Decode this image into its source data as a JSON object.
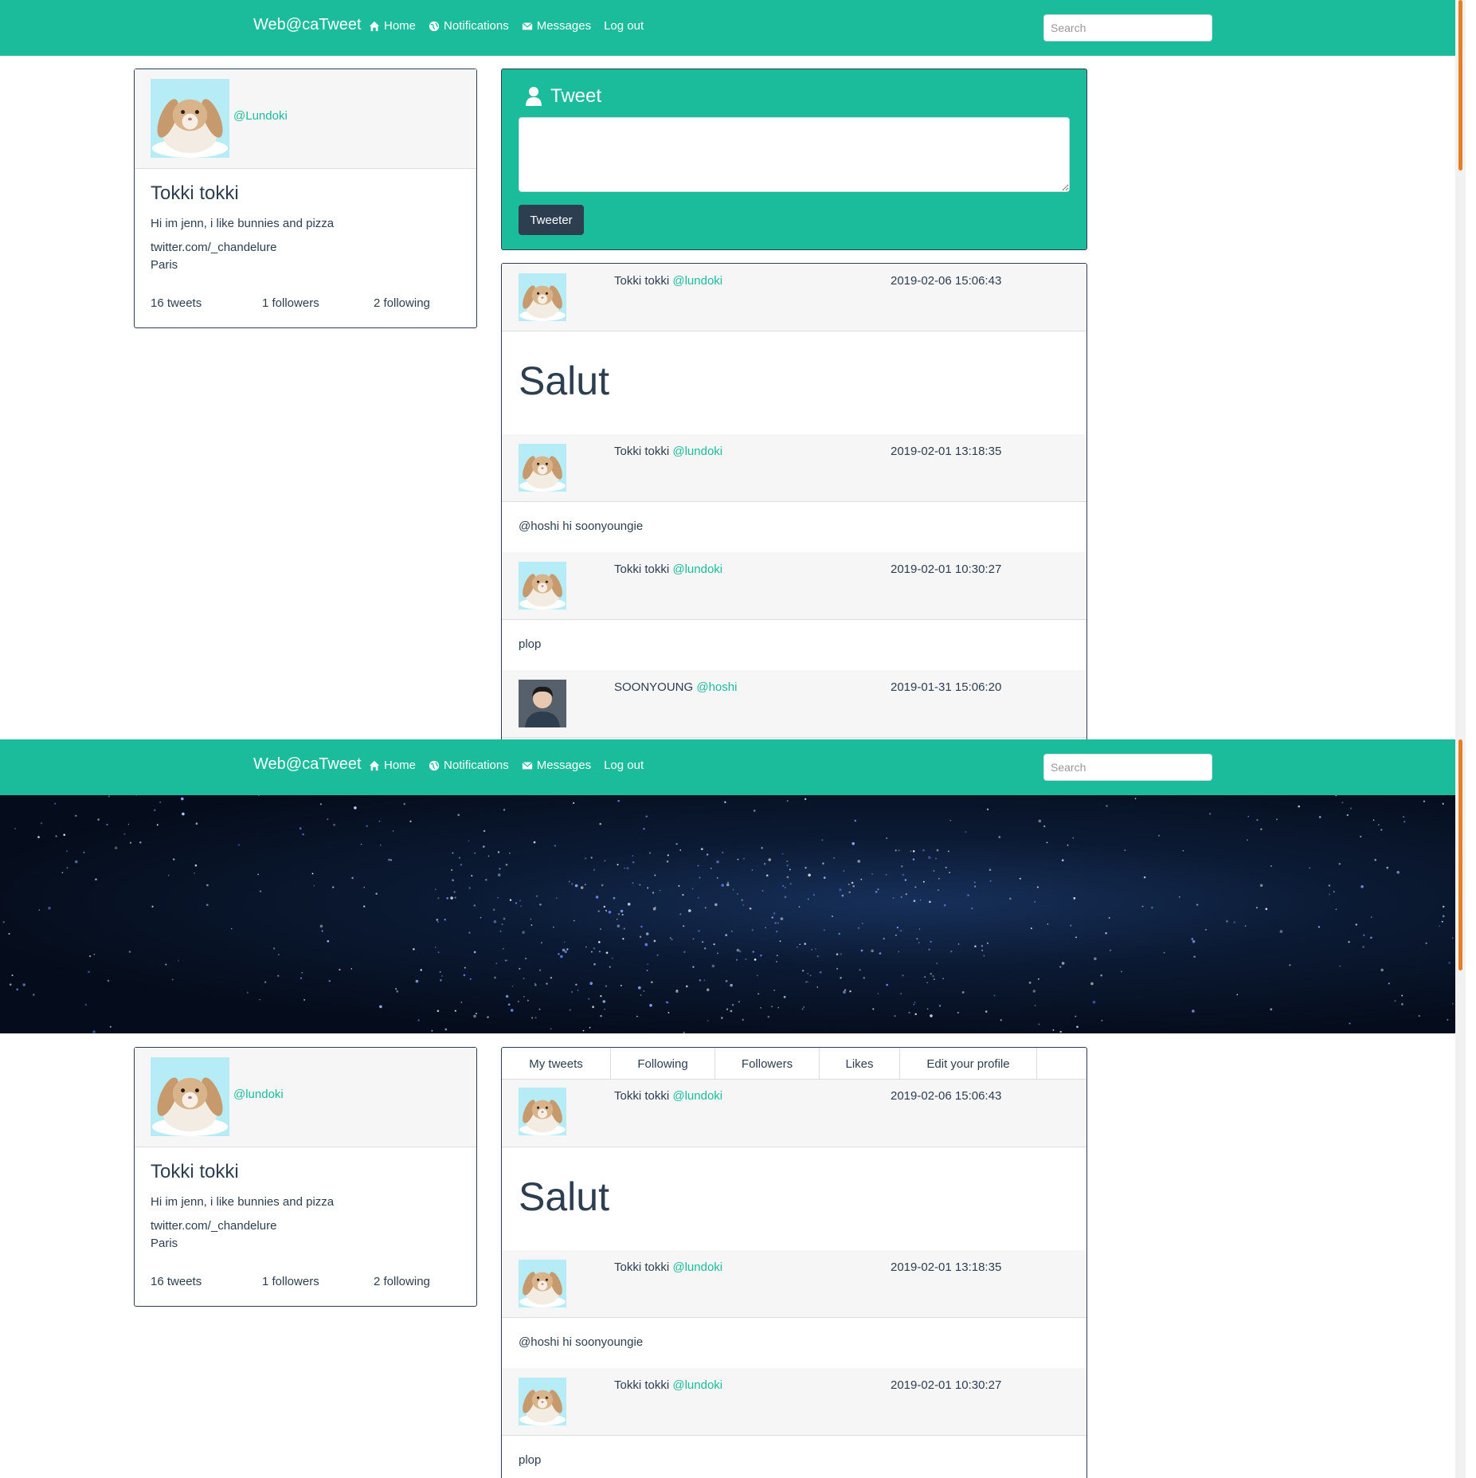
{
  "navbar": {
    "brand": "Web@caTweet",
    "links": [
      {
        "label": "Home",
        "icon": "home-icon"
      },
      {
        "label": "Notifications",
        "icon": "globe-icon"
      },
      {
        "label": "Messages",
        "icon": "envelope-icon"
      },
      {
        "label": "Log out",
        "icon": ""
      }
    ],
    "search_placeholder": "Search"
  },
  "colors": {
    "accent": "#1abc9c",
    "dark": "#2c3e50",
    "scroll": "#e67e22"
  },
  "home_profile": {
    "handle": "@Lundoki",
    "name": "Tokki tokki",
    "bio": "Hi im jenn, i like bunnies and pizza",
    "link": "twitter.com/_chandelure",
    "city": "Paris",
    "tweets": "16 tweets",
    "followers": "1 followers",
    "following": "2 following"
  },
  "tweet_box": {
    "title": "Tweet",
    "button": "Tweeter"
  },
  "home_feed": [
    {
      "author": "Tokki tokki",
      "handle": "@lundoki",
      "date": "2019-02-06 15:06:43",
      "text": "Salut",
      "avatar": "bunny"
    },
    {
      "author": "Tokki tokki",
      "handle": "@lundoki",
      "date": "2019-02-01 13:18:35",
      "text": "@hoshi hi soonyoungie",
      "avatar": "bunny"
    },
    {
      "author": "Tokki tokki",
      "handle": "@lundoki",
      "date": "2019-02-01 10:30:27",
      "text": "plop",
      "avatar": "bunny"
    },
    {
      "author": "SOONYOUNG",
      "handle": "@hoshi",
      "date": "2019-01-31 15:06:20",
      "text": "",
      "avatar": "person"
    }
  ],
  "profile_page": {
    "handle": "@lundoki",
    "name": "Tokki tokki",
    "bio": "Hi im jenn, i like bunnies and pizza",
    "link": "twitter.com/_chandelure",
    "city": "Paris",
    "tweets": "16 tweets",
    "followers": "1 followers",
    "following": "2 following",
    "tabs": [
      "My tweets",
      "Following",
      "Followers",
      "Likes",
      "Edit your profile"
    ]
  },
  "profile_feed": [
    {
      "author": "Tokki tokki",
      "handle": "@lundoki",
      "date": "2019-02-06 15:06:43",
      "text": "Salut"
    },
    {
      "author": "Tokki tokki",
      "handle": "@lundoki",
      "date": "2019-02-01 13:18:35",
      "text": "@hoshi hi soonyoungie"
    },
    {
      "author": "Tokki tokki",
      "handle": "@lundoki",
      "date": "2019-02-01 10:30:27",
      "text": "plop"
    }
  ]
}
